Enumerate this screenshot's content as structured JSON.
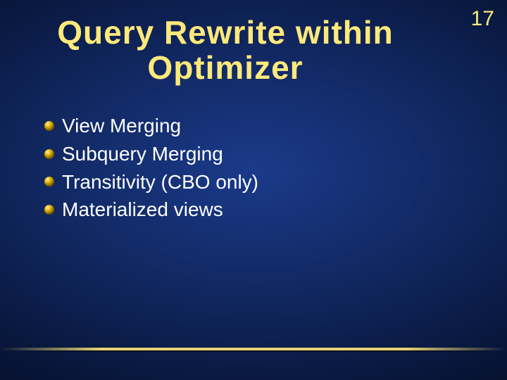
{
  "page_number": "17",
  "title_line1": "Query Rewrite within",
  "title_line2": "Optimizer",
  "bullets": {
    "b0": "View Merging",
    "b1": "Subquery Merging",
    "b2": "Transitivity (CBO only)",
    "b3": "Materialized views"
  },
  "colors": {
    "accent": "#ffe97a",
    "bullet_fill": "#e0b000",
    "bullet_shine": "#fff4b0"
  }
}
